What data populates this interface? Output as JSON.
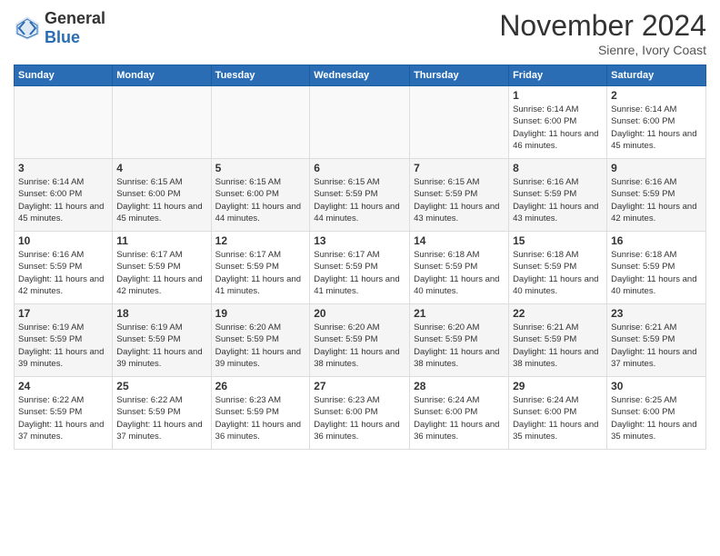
{
  "header": {
    "logo_general": "General",
    "logo_blue": "Blue",
    "month_title": "November 2024",
    "subtitle": "Sienre, Ivory Coast"
  },
  "weekdays": [
    "Sunday",
    "Monday",
    "Tuesday",
    "Wednesday",
    "Thursday",
    "Friday",
    "Saturday"
  ],
  "weeks": [
    [
      {
        "day": "",
        "info": ""
      },
      {
        "day": "",
        "info": ""
      },
      {
        "day": "",
        "info": ""
      },
      {
        "day": "",
        "info": ""
      },
      {
        "day": "",
        "info": ""
      },
      {
        "day": "1",
        "info": "Sunrise: 6:14 AM\nSunset: 6:00 PM\nDaylight: 11 hours and 46 minutes."
      },
      {
        "day": "2",
        "info": "Sunrise: 6:14 AM\nSunset: 6:00 PM\nDaylight: 11 hours and 45 minutes."
      }
    ],
    [
      {
        "day": "3",
        "info": "Sunrise: 6:14 AM\nSunset: 6:00 PM\nDaylight: 11 hours and 45 minutes."
      },
      {
        "day": "4",
        "info": "Sunrise: 6:15 AM\nSunset: 6:00 PM\nDaylight: 11 hours and 45 minutes."
      },
      {
        "day": "5",
        "info": "Sunrise: 6:15 AM\nSunset: 6:00 PM\nDaylight: 11 hours and 44 minutes."
      },
      {
        "day": "6",
        "info": "Sunrise: 6:15 AM\nSunset: 5:59 PM\nDaylight: 11 hours and 44 minutes."
      },
      {
        "day": "7",
        "info": "Sunrise: 6:15 AM\nSunset: 5:59 PM\nDaylight: 11 hours and 43 minutes."
      },
      {
        "day": "8",
        "info": "Sunrise: 6:16 AM\nSunset: 5:59 PM\nDaylight: 11 hours and 43 minutes."
      },
      {
        "day": "9",
        "info": "Sunrise: 6:16 AM\nSunset: 5:59 PM\nDaylight: 11 hours and 42 minutes."
      }
    ],
    [
      {
        "day": "10",
        "info": "Sunrise: 6:16 AM\nSunset: 5:59 PM\nDaylight: 11 hours and 42 minutes."
      },
      {
        "day": "11",
        "info": "Sunrise: 6:17 AM\nSunset: 5:59 PM\nDaylight: 11 hours and 42 minutes."
      },
      {
        "day": "12",
        "info": "Sunrise: 6:17 AM\nSunset: 5:59 PM\nDaylight: 11 hours and 41 minutes."
      },
      {
        "day": "13",
        "info": "Sunrise: 6:17 AM\nSunset: 5:59 PM\nDaylight: 11 hours and 41 minutes."
      },
      {
        "day": "14",
        "info": "Sunrise: 6:18 AM\nSunset: 5:59 PM\nDaylight: 11 hours and 40 minutes."
      },
      {
        "day": "15",
        "info": "Sunrise: 6:18 AM\nSunset: 5:59 PM\nDaylight: 11 hours and 40 minutes."
      },
      {
        "day": "16",
        "info": "Sunrise: 6:18 AM\nSunset: 5:59 PM\nDaylight: 11 hours and 40 minutes."
      }
    ],
    [
      {
        "day": "17",
        "info": "Sunrise: 6:19 AM\nSunset: 5:59 PM\nDaylight: 11 hours and 39 minutes."
      },
      {
        "day": "18",
        "info": "Sunrise: 6:19 AM\nSunset: 5:59 PM\nDaylight: 11 hours and 39 minutes."
      },
      {
        "day": "19",
        "info": "Sunrise: 6:20 AM\nSunset: 5:59 PM\nDaylight: 11 hours and 39 minutes."
      },
      {
        "day": "20",
        "info": "Sunrise: 6:20 AM\nSunset: 5:59 PM\nDaylight: 11 hours and 38 minutes."
      },
      {
        "day": "21",
        "info": "Sunrise: 6:20 AM\nSunset: 5:59 PM\nDaylight: 11 hours and 38 minutes."
      },
      {
        "day": "22",
        "info": "Sunrise: 6:21 AM\nSunset: 5:59 PM\nDaylight: 11 hours and 38 minutes."
      },
      {
        "day": "23",
        "info": "Sunrise: 6:21 AM\nSunset: 5:59 PM\nDaylight: 11 hours and 37 minutes."
      }
    ],
    [
      {
        "day": "24",
        "info": "Sunrise: 6:22 AM\nSunset: 5:59 PM\nDaylight: 11 hours and 37 minutes."
      },
      {
        "day": "25",
        "info": "Sunrise: 6:22 AM\nSunset: 5:59 PM\nDaylight: 11 hours and 37 minutes."
      },
      {
        "day": "26",
        "info": "Sunrise: 6:23 AM\nSunset: 5:59 PM\nDaylight: 11 hours and 36 minutes."
      },
      {
        "day": "27",
        "info": "Sunrise: 6:23 AM\nSunset: 6:00 PM\nDaylight: 11 hours and 36 minutes."
      },
      {
        "day": "28",
        "info": "Sunrise: 6:24 AM\nSunset: 6:00 PM\nDaylight: 11 hours and 36 minutes."
      },
      {
        "day": "29",
        "info": "Sunrise: 6:24 AM\nSunset: 6:00 PM\nDaylight: 11 hours and 35 minutes."
      },
      {
        "day": "30",
        "info": "Sunrise: 6:25 AM\nSunset: 6:00 PM\nDaylight: 11 hours and 35 minutes."
      }
    ]
  ]
}
